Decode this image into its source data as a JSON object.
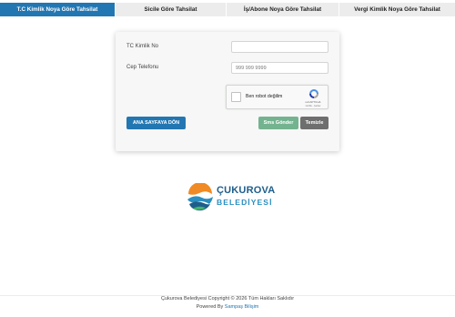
{
  "tabs": [
    {
      "label": "T.C Kimlik Noya Göre Tahsilat",
      "active": true
    },
    {
      "label": "Sicile Göre Tahsilat",
      "active": false
    },
    {
      "label": "İş/Abone Noya Göre Tahsilat",
      "active": false
    },
    {
      "label": "Vergi Kimlik Noya Göre Tahsilat",
      "active": false
    }
  ],
  "form": {
    "tc_label": "TC Kimlik No",
    "tc_value": "",
    "phone_label": "Cep Telefonu",
    "phone_placeholder": "999 999 9999",
    "captcha": {
      "label": "Ben robot değilim",
      "brand": "reCAPTCHA",
      "terms": "Gizlilik - Şartlar"
    },
    "home_button": "ANA SAYFAYA DÖN",
    "sms_button": "Sms Gönder",
    "clear_button": "Temizle"
  },
  "logo": {
    "line1": "ÇUKUROVA",
    "line2": "BELEDİYESİ"
  },
  "footer": {
    "copyright": "Çukurova Belediyesi Copyright © 2026 Tüm Hakları Saklıdır",
    "powered_prefix": "Powered By",
    "powered_link": "Sampaş Bilişim"
  },
  "colors": {
    "accent": "#2277b2",
    "sms_button": "#74b38f",
    "clear_button": "#6e6e6e"
  }
}
